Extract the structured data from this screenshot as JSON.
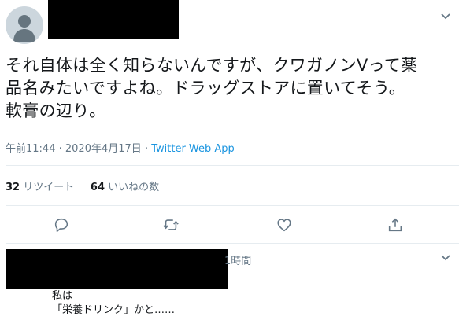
{
  "tweet": {
    "text_line1": "それ自体は全く知らないんですが、クワガノンVって薬",
    "text_line2": "品名みたいですよね。ドラッグストアに置いてそう。",
    "text_line3": "軟膏の辺り。",
    "time": "午前11:44",
    "separator": "·",
    "date": "2020年4月17日",
    "source": "Twitter Web App",
    "retweet_count": "32",
    "retweet_label": "リツイート",
    "like_count": "64",
    "like_label": "いいねの数"
  },
  "actions": {
    "icons": [
      "reply-icon",
      "retweet-icon",
      "like-icon",
      "share-icon"
    ]
  },
  "reply": {
    "time": "1時間",
    "text_line1": "私は",
    "text_line2": "「栄養ドリンク」かと……"
  },
  "colors": {
    "muted": "#657786",
    "link": "#1b95e0",
    "divider": "#e6ecf0",
    "avatar_bg": "#ccd6dd",
    "avatar_fg": "#66757f"
  }
}
